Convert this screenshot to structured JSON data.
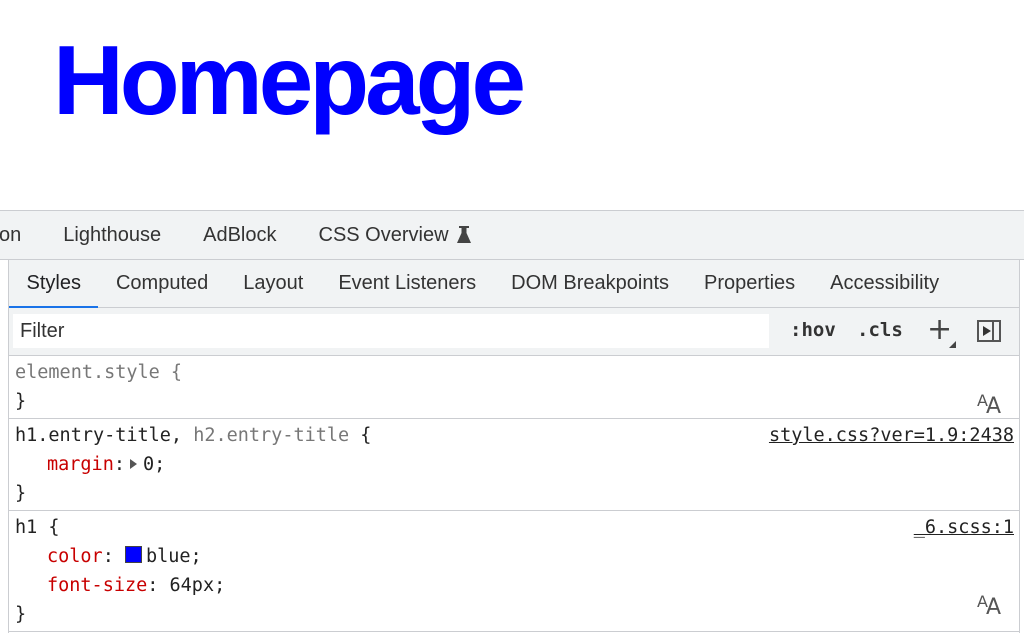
{
  "page": {
    "heading": "Homepage",
    "heading_color": "#0000ff"
  },
  "devtools": {
    "main_tabs": [
      {
        "label": "on"
      },
      {
        "label": "Lighthouse"
      },
      {
        "label": "AdBlock"
      },
      {
        "label": "CSS Overview",
        "icon": "flask-icon"
      }
    ],
    "sub_tabs": [
      {
        "label": "Styles",
        "active": true
      },
      {
        "label": "Computed"
      },
      {
        "label": "Layout"
      },
      {
        "label": "Event Listeners"
      },
      {
        "label": "DOM Breakpoints"
      },
      {
        "label": "Properties"
      },
      {
        "label": "Accessibility"
      }
    ],
    "toolbar": {
      "filter_placeholder": "Filter",
      "hov_label": ":hov",
      "cls_label": ".cls",
      "plus_label": "+",
      "sidebar_toggle_icon": "sidebar-toggle-icon"
    },
    "rules": [
      {
        "selector": "element.style {",
        "close": "}",
        "font_icon": "AA"
      },
      {
        "selector_main": "h1.entry-title,",
        "selector_dim": " h2.entry-title",
        "selector_brace": " {",
        "source": "style.css?ver=1.9:2438",
        "props": [
          {
            "name": "margin",
            "value": "0;"
          }
        ],
        "close": "}"
      },
      {
        "selector": "h1 {",
        "source": "_6.scss:1",
        "props": [
          {
            "name": "color",
            "value": "blue;",
            "swatch": "#0000ff"
          },
          {
            "name": "font-size",
            "value": "64px;"
          }
        ],
        "close": "}",
        "font_icon": "AA"
      }
    ]
  }
}
